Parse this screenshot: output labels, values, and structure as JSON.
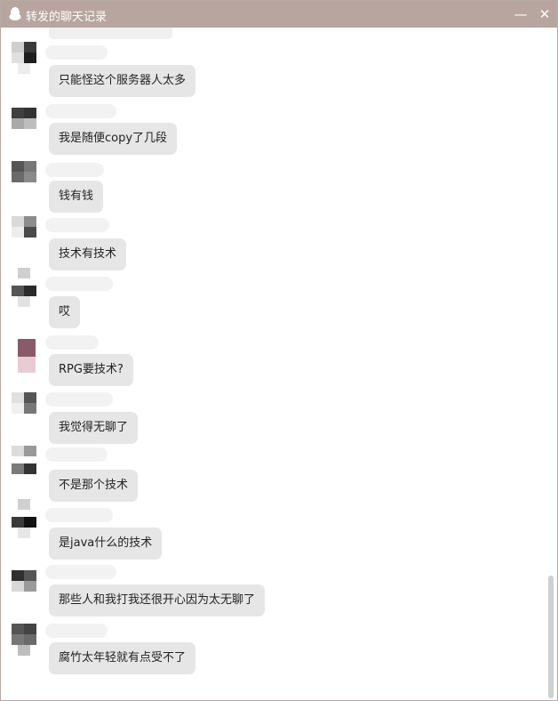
{
  "window": {
    "title": "转发的聊天记录"
  },
  "controls": {
    "minimize": "—",
    "close": "✕"
  },
  "messages": [
    {
      "text": "只能怪这个服务器人太多"
    },
    {
      "text": "我是随便copy了几段"
    },
    {
      "text": "钱有钱"
    },
    {
      "text": "技术有技术"
    },
    {
      "text": "哎"
    },
    {
      "text": "RPG要技术?"
    },
    {
      "text": "我觉得无聊了"
    },
    {
      "text": "不是那个技术"
    },
    {
      "text": "是java什么的技术"
    },
    {
      "text": "那些人和我打我还很开心因为太无聊了"
    },
    {
      "text": "腐竹太年轻就有点受不了"
    }
  ]
}
